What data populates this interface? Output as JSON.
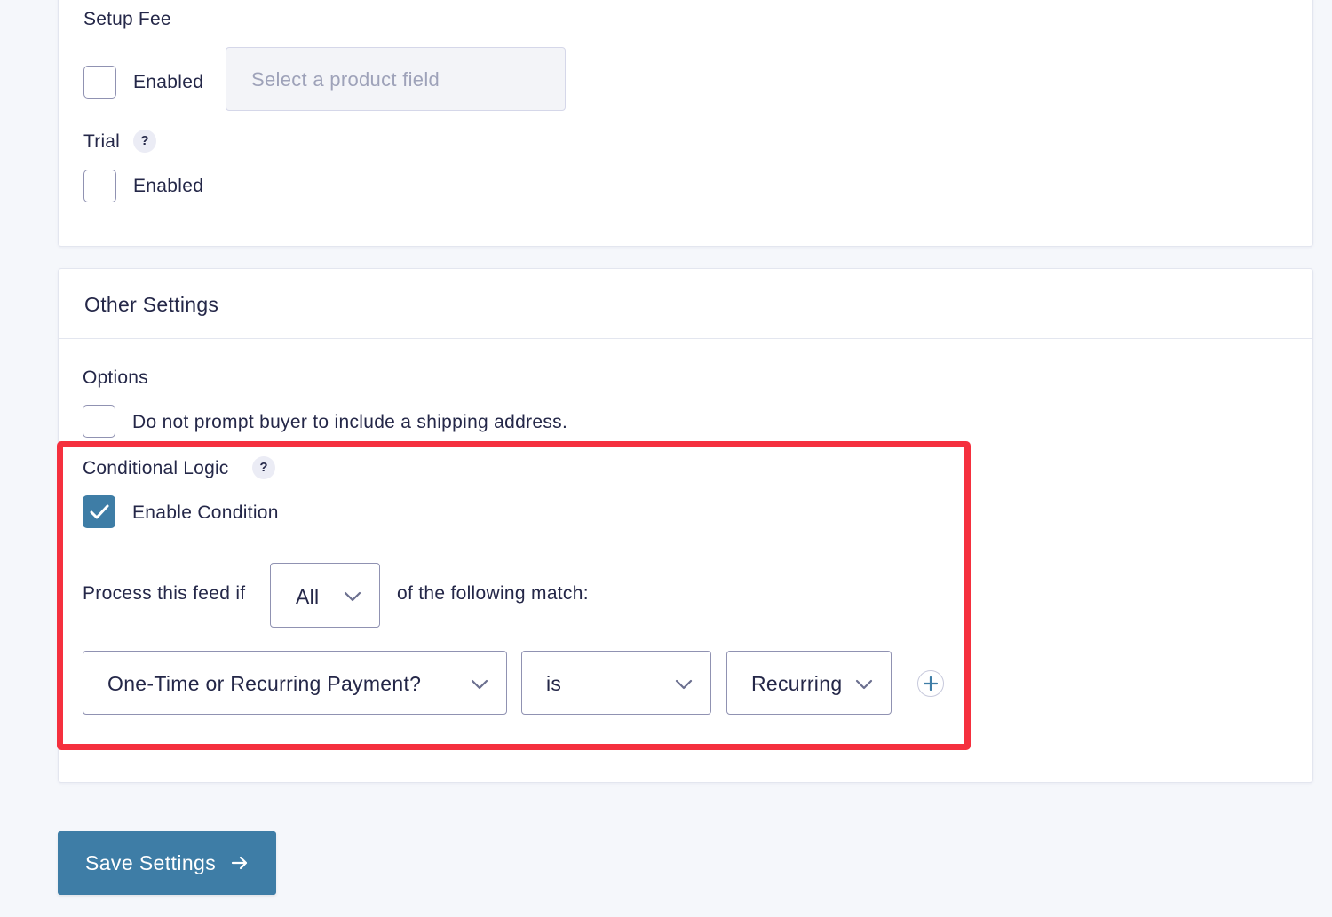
{
  "setup_fee": {
    "title": "Setup Fee",
    "checkbox_label": "Enabled",
    "checked": false,
    "product_field_placeholder": "Select a product field"
  },
  "trial": {
    "title": "Trial",
    "help": "?",
    "checkbox_label": "Enabled",
    "checked": false
  },
  "other_settings": {
    "title": "Other Settings",
    "options": {
      "title": "Options",
      "checkbox_label": "Do not prompt buyer to include a shipping address.",
      "checked": false
    },
    "conditional_logic": {
      "title": "Conditional Logic",
      "help": "?",
      "enable_label": "Enable Condition",
      "enabled": true,
      "process_prefix": "Process this feed if",
      "match_type": "All",
      "process_suffix": "of the following match:",
      "rule": {
        "field": "One-Time or Recurring Payment?",
        "operator": "is",
        "value": "Recurring"
      }
    }
  },
  "footer": {
    "save_label": "Save Settings"
  },
  "colors": {
    "accent": "#3e7da6",
    "highlight": "#f5303e",
    "text": "#242748",
    "background": "#f5f7fb"
  },
  "icons": [
    "question-icon",
    "checkmark-icon",
    "chevron-down-icon",
    "plus-icon",
    "arrow-right-icon"
  ]
}
